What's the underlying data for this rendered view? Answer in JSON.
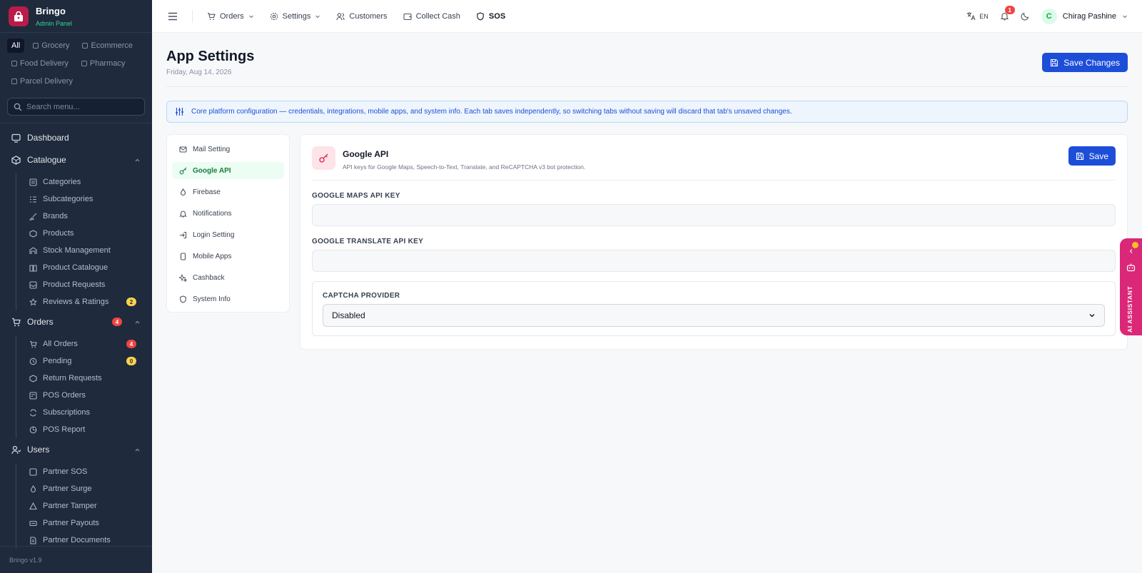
{
  "brand": {
    "name": "Bringo",
    "subtitle": "Admin Panel"
  },
  "filters": [
    {
      "label": "All",
      "active": true
    },
    {
      "label": "Grocery"
    },
    {
      "label": "Ecommerce"
    },
    {
      "label": "Food Delivery"
    },
    {
      "label": "Pharmacy"
    },
    {
      "label": "Parcel Delivery"
    }
  ],
  "search": {
    "placeholder": "Search menu..."
  },
  "nav": {
    "dashboard": "Dashboard",
    "catalogue": {
      "label": "Catalogue",
      "items": [
        "Categories",
        "Subcategories",
        "Brands",
        "Products",
        "Stock Management",
        "Product Catalogue",
        "Product Requests",
        "Reviews & Ratings"
      ],
      "reviews_badge": "2"
    },
    "orders": {
      "label": "Orders",
      "badge": "4",
      "items": [
        "All Orders",
        "Pending",
        "Return Requests",
        "POS Orders",
        "Subscriptions",
        "POS Report"
      ],
      "all_orders_badge": "4",
      "pending_badge": "0"
    },
    "users": {
      "label": "Users",
      "items": [
        "Partner SOS",
        "Partner Surge",
        "Partner Tamper",
        "Partner Payouts",
        "Partner Documents"
      ]
    }
  },
  "version": "Bringo v1.9",
  "topbar": {
    "orders": "Orders",
    "settings": "Settings",
    "customers": "Customers",
    "collect_cash": "Collect Cash",
    "sos": "SOS",
    "lang": "EN",
    "notifications_badge": "1",
    "user_initial": "C",
    "user_name": "Chirag Pashine"
  },
  "page": {
    "title": "App Settings",
    "date": "Friday, Aug 14, 2026",
    "save_changes": "Save Changes",
    "info": "Core platform configuration — credentials, integrations, mobile apps, and system info. Each tab saves independently, so switching tabs without saving will discard that tab's unsaved changes."
  },
  "tabs": [
    "Mail Setting",
    "Google API",
    "Firebase",
    "Notifications",
    "Login Setting",
    "Mobile Apps",
    "Cashback",
    "System Info"
  ],
  "panel": {
    "title": "Google API",
    "description": "API keys for Google Maps, Speech-to-Text, Translate, and ReCAPTCHA v3 bot protection.",
    "save": "Save",
    "maps_label": "GOOGLE MAPS API KEY",
    "maps_value": "",
    "translate_label": "GOOGLE TRANSLATE API KEY",
    "translate_value": "",
    "captcha_label": "CAPTCHA PROVIDER",
    "captcha_value": "Disabled"
  },
  "ai_assistant": "AI ASSISTANT",
  "colors": {
    "sidebar_bg": "#1f2a3c",
    "primary": "#1d4ed8",
    "accent_green": "#15803d",
    "ai_pink": "#db2777"
  }
}
